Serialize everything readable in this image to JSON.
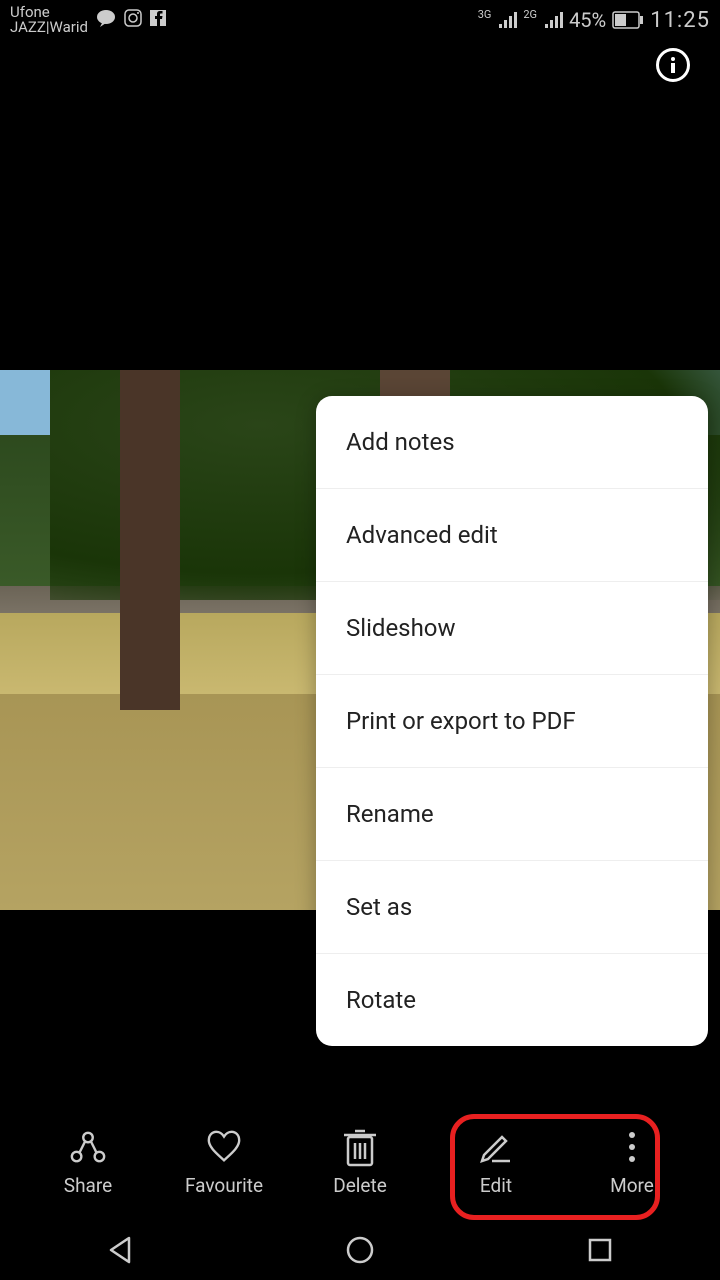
{
  "status": {
    "carrier1": "Ufone",
    "carrier2": "JAZZ|Warid",
    "net1": "3G",
    "net2": "2G",
    "battery": "45%",
    "time": "11:25"
  },
  "menu": {
    "items": [
      "Add notes",
      "Advanced edit",
      "Slideshow",
      "Print or export to PDF",
      "Rename",
      "Set as",
      "Rotate"
    ]
  },
  "bottom": {
    "share": "Share",
    "favourite": "Favourite",
    "delete": "Delete",
    "edit": "Edit",
    "more": "More"
  }
}
